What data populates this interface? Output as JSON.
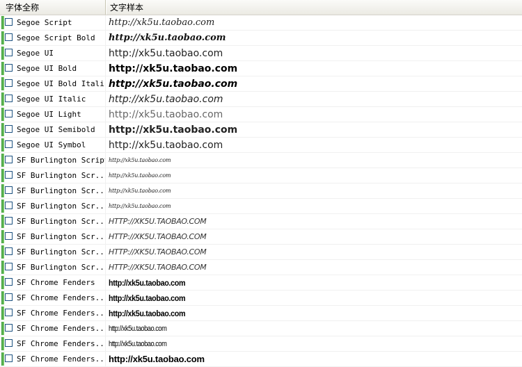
{
  "header": {
    "col_name": "字体全称",
    "col_sample": "文字样本"
  },
  "rows": [
    {
      "name": "Segoe Script",
      "sample": "http://xk5u.taobao.com",
      "style": "s-script"
    },
    {
      "name": "Segoe Script Bold",
      "sample": "http://xk5u.taobao.com",
      "style": "s-script-bold"
    },
    {
      "name": "Segoe UI",
      "sample": "http://xk5u.taobao.com",
      "style": "s-ui"
    },
    {
      "name": "Segoe UI Bold",
      "sample": "http://xk5u.taobao.com",
      "style": "s-ui-bold"
    },
    {
      "name": "Segoe UI Bold Italic",
      "sample": "http://xk5u.taobao.com",
      "style": "s-ui-bold-italic"
    },
    {
      "name": "Segoe UI Italic",
      "sample": "http://xk5u.taobao.com",
      "style": "s-ui-italic"
    },
    {
      "name": "Segoe UI Light",
      "sample": "http://xk5u.taobao.com",
      "style": "s-ui-light"
    },
    {
      "name": "Segoe UI Semibold",
      "sample": "http://xk5u.taobao.com",
      "style": "s-ui-semibold"
    },
    {
      "name": "Segoe UI Symbol",
      "sample": "http://xk5u.taobao.com",
      "style": "s-ui-symbol"
    },
    {
      "name": "SF Burlington Script",
      "sample": "http://xk5u.taobao.com",
      "style": "s-burl"
    },
    {
      "name": "SF Burlington Scr...",
      "sample": "http://xk5u.taobao.com",
      "style": "s-burl"
    },
    {
      "name": "SF Burlington Scr...",
      "sample": "http://xk5u.taobao.com",
      "style": "s-burl"
    },
    {
      "name": "SF Burlington Scr...",
      "sample": "http://xk5u.taobao.com",
      "style": "s-burl"
    },
    {
      "name": "SF Burlington Scr...",
      "sample": "HTTP://XK5U.TAOBAO.COM",
      "style": "s-burl-caps"
    },
    {
      "name": "SF Burlington Scr...",
      "sample": "HTTP://XK5U.TAOBAO.COM",
      "style": "s-burl-caps"
    },
    {
      "name": "SF Burlington Scr...",
      "sample": "HTTP://XK5U.TAOBAO.COM",
      "style": "s-burl-caps"
    },
    {
      "name": "SF Burlington Scr...",
      "sample": "HTTP://XK5U.TAOBAO.COM",
      "style": "s-burl-caps"
    },
    {
      "name": "SF Chrome Fenders",
      "sample": "http://xk5u.taobao.com",
      "style": "s-chrome"
    },
    {
      "name": "SF Chrome Fenders...",
      "sample": "http://xk5u.taobao.com",
      "style": "s-chrome"
    },
    {
      "name": "SF Chrome Fenders...",
      "sample": "http://xk5u.taobao.com",
      "style": "s-chrome"
    },
    {
      "name": "SF Chrome Fenders...",
      "sample": "http://xk5u.taobao.com",
      "style": "s-chrome-narrow"
    },
    {
      "name": "SF Chrome Fenders...",
      "sample": "http://xk5u.taobao.com",
      "style": "s-chrome-narrow"
    },
    {
      "name": "SF Chrome Fenders...",
      "sample": "http://xk5u.taobao.com",
      "style": "s-chrome-wide"
    }
  ]
}
